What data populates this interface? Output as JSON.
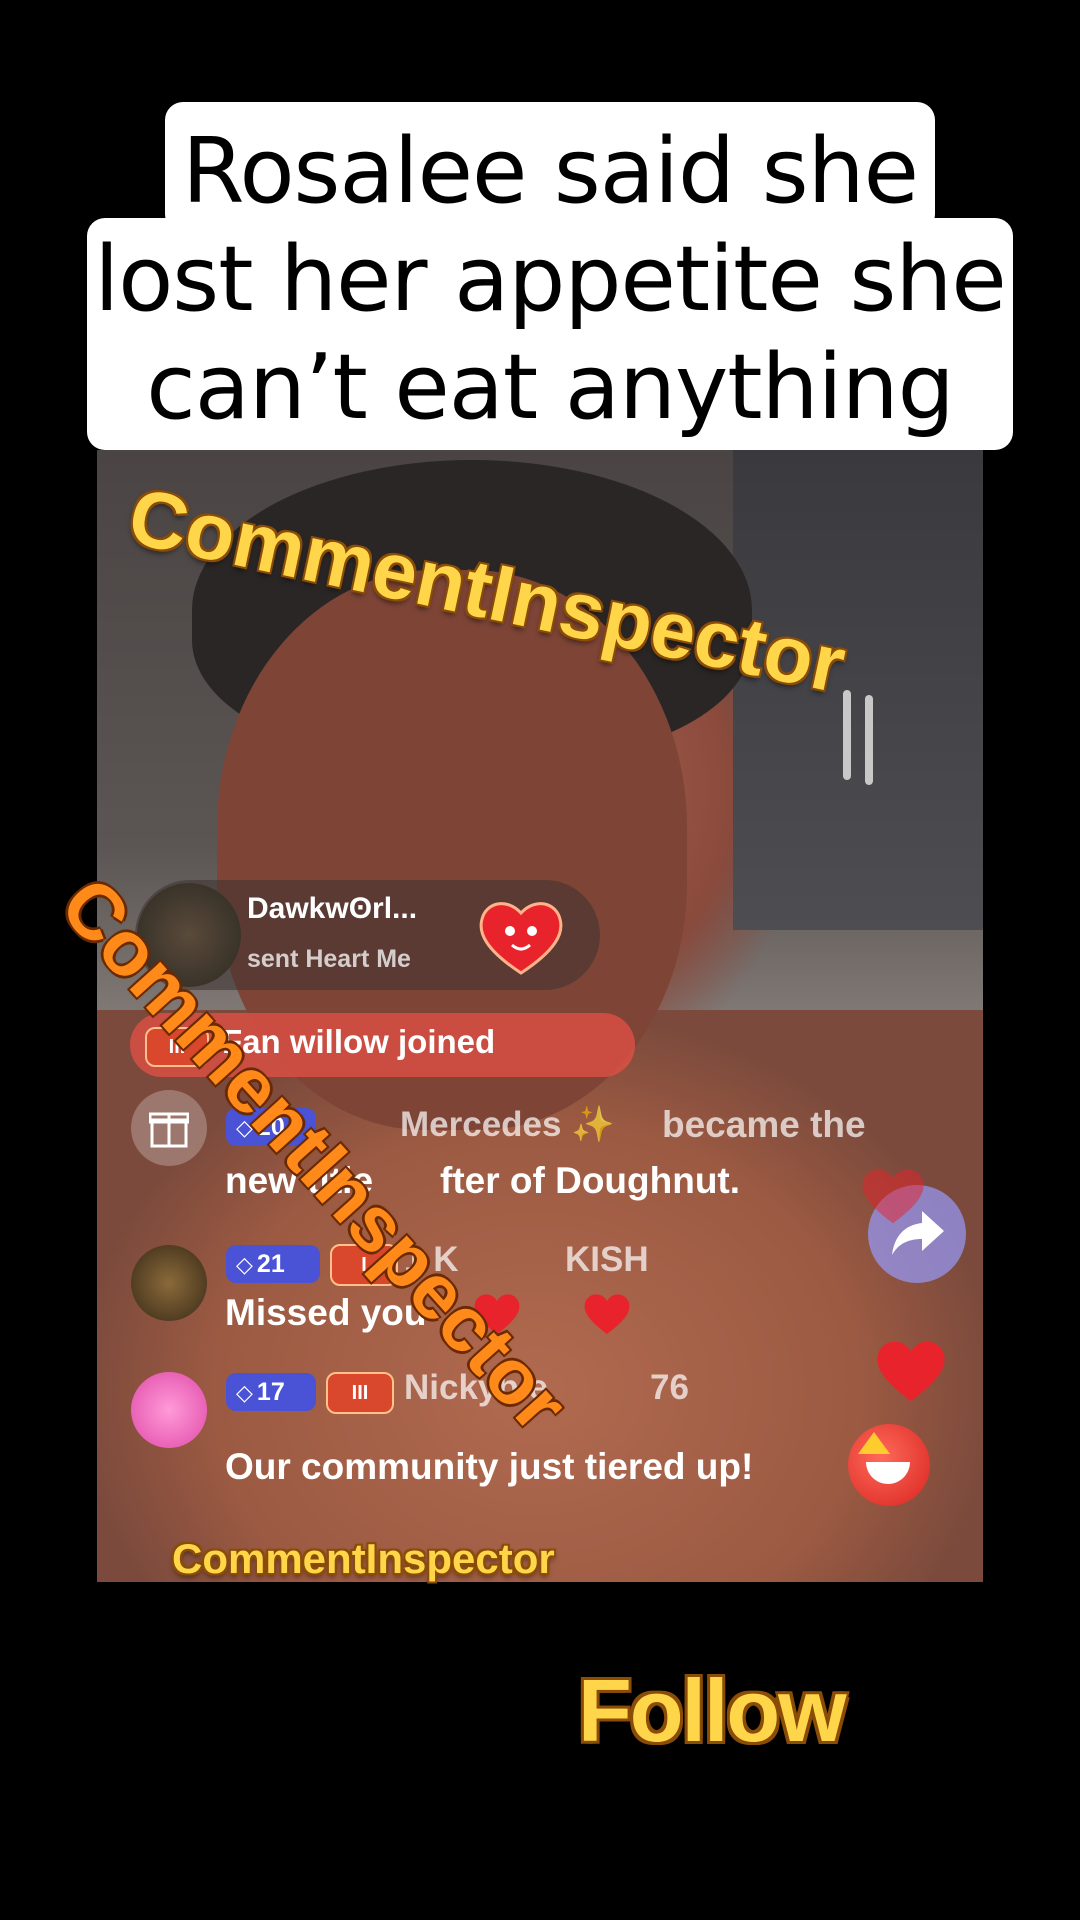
{
  "caption": {
    "lines": [
      "Rosalee said she",
      "lost her appetite she",
      "can’t eat anything"
    ]
  },
  "gift_banner": {
    "sender": "Dawkwʘrl...",
    "message": "sent Heart Me"
  },
  "join_notice": {
    "badge": "III",
    "text": "Fan willow joined"
  },
  "comments": [
    {
      "level": "20",
      "username": "Mercedes ✨",
      "text_line1": "became the",
      "text_line2": "new title",
      "text_line2b": "fter of Doughnut."
    },
    {
      "level": "21",
      "fan_badge": "I",
      "username": "1 K",
      "username_tail": "KISH",
      "text": "Missed you"
    },
    {
      "level": "17",
      "fan_badge": "III",
      "username": "Nickyble",
      "username_tail": "76",
      "text": "Our community just tiered up!"
    }
  ],
  "watermarks": [
    "CommentInspector",
    "CommentInspector",
    "CommentInspector"
  ],
  "follow_label": "Follow",
  "colors": {
    "watermark_yellow": "#ffd64a",
    "watermark_orange": "#ff8a1a",
    "level_badge": "#4a52d6",
    "fan_badge": "#d9472c",
    "join_bar": "#e65046",
    "heart_red": "#e8232b"
  },
  "icons": [
    "gift-icon",
    "share-icon",
    "heart-icon",
    "heart-gift-icon",
    "laughing-emoji-icon",
    "diamond-gem-icon"
  ]
}
